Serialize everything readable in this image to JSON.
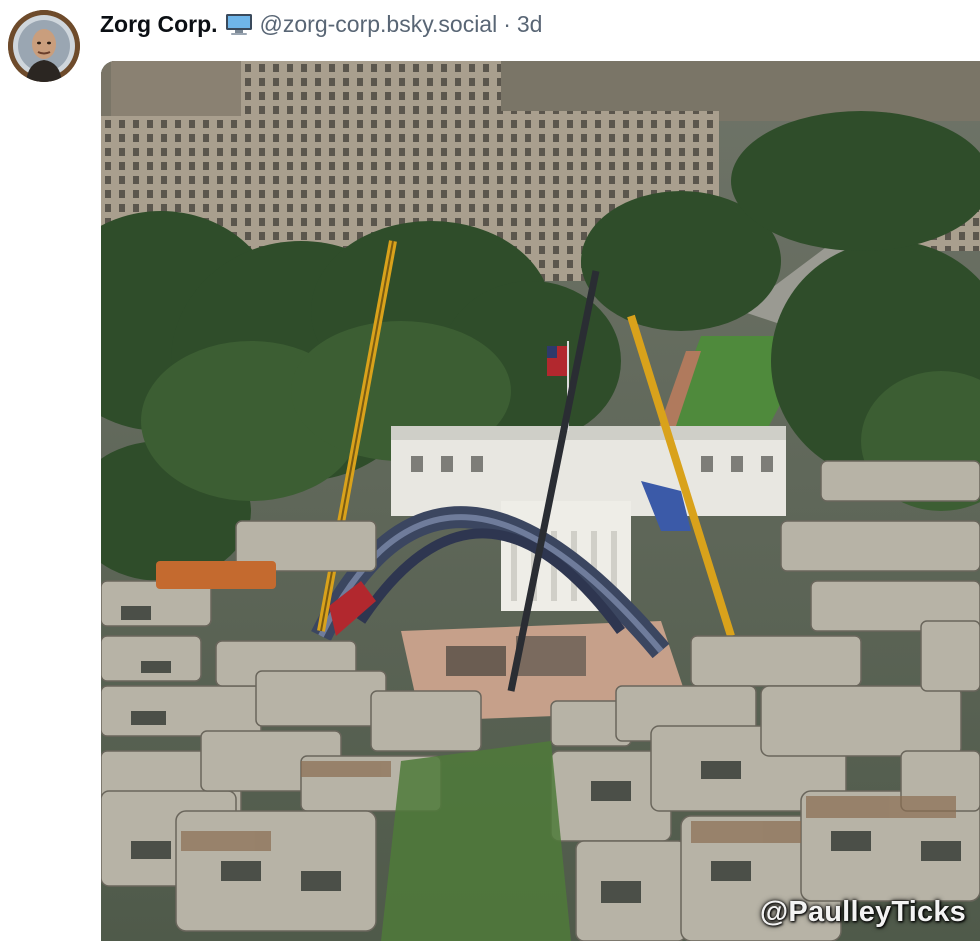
{
  "post": {
    "author_name": "Zorg Corp.",
    "author_badge_icon": "computer-monitor-icon",
    "handle": "@zorg-corp.bsky.social",
    "separator": "·",
    "time": "3d"
  },
  "image": {
    "watermark": "@PaulleyTicks"
  },
  "colors": {
    "name": "#0b0f14",
    "muted": "#596675",
    "lawn": "#4f7a3a",
    "crane_yellow": "#d9a21b",
    "arch": "#3b4660",
    "trailer": "#b7b3a6"
  }
}
